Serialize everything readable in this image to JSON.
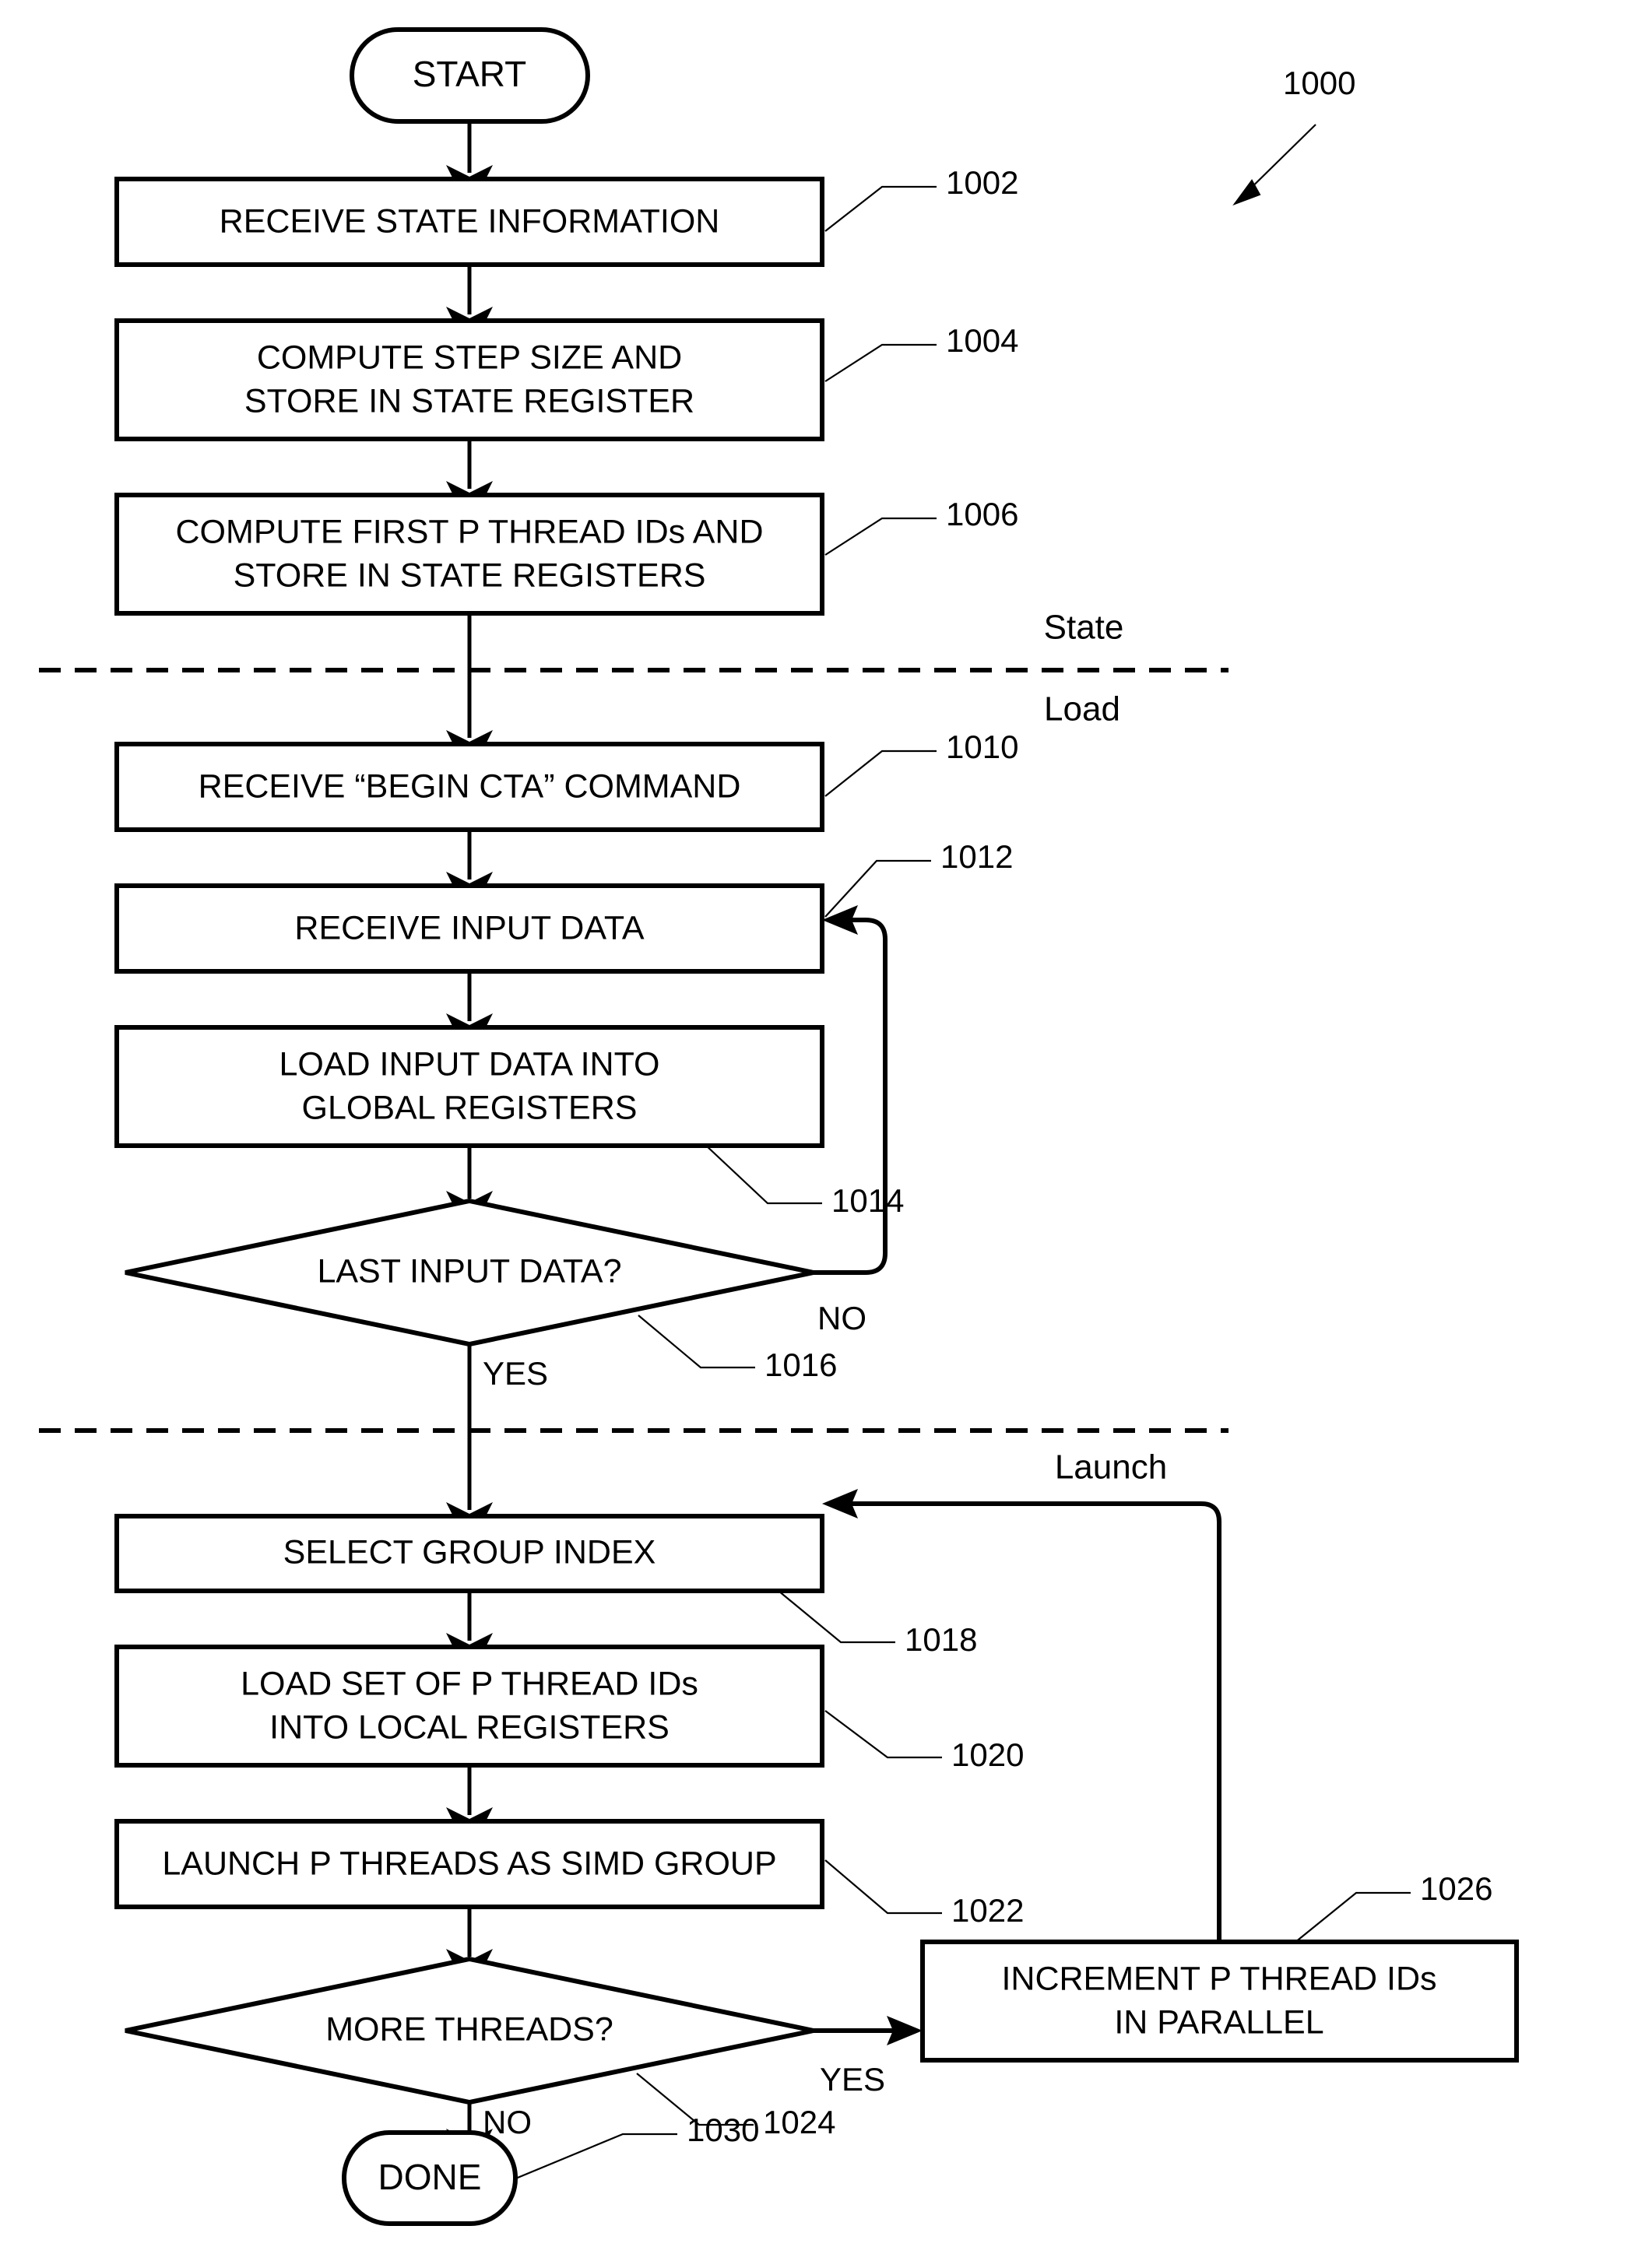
{
  "figure": {
    "number": "1000",
    "type": "flowchart"
  },
  "terminals": {
    "start": {
      "label": "START"
    },
    "done": {
      "label": "DONE",
      "ref": "1030"
    }
  },
  "steps": [
    {
      "id": "s1002",
      "ref": "1002",
      "lines": [
        "RECEIVE STATE INFORMATION"
      ]
    },
    {
      "id": "s1004",
      "ref": "1004",
      "lines": [
        "COMPUTE STEP SIZE AND",
        "STORE IN STATE REGISTER"
      ]
    },
    {
      "id": "s1006",
      "ref": "1006",
      "lines": [
        "COMPUTE FIRST P THREAD IDs AND",
        "STORE IN STATE REGISTERS"
      ]
    },
    {
      "id": "s1010",
      "ref": "1010",
      "lines": [
        "RECEIVE “BEGIN CTA” COMMAND"
      ]
    },
    {
      "id": "s1012",
      "ref": "1012",
      "lines": [
        "RECEIVE INPUT DATA"
      ]
    },
    {
      "id": "s1014",
      "ref": "1014",
      "lines": [
        "LOAD INPUT DATA INTO",
        "GLOBAL REGISTERS"
      ]
    },
    {
      "id": "s1018",
      "ref": "1018",
      "lines": [
        "SELECT GROUP INDEX"
      ]
    },
    {
      "id": "s1020",
      "ref": "1020",
      "lines": [
        "LOAD SET OF P THREAD IDs",
        "INTO LOCAL REGISTERS"
      ]
    },
    {
      "id": "s1022",
      "ref": "1022",
      "lines": [
        "LAUNCH P THREADS AS SIMD GROUP"
      ]
    },
    {
      "id": "s1026",
      "ref": "1026",
      "lines": [
        "INCREMENT P THREAD IDs",
        "IN PARALLEL"
      ]
    }
  ],
  "decisions": [
    {
      "id": "d1016",
      "ref": "1016",
      "label": "LAST INPUT DATA?",
      "yes_label": "YES",
      "no_label": "NO"
    },
    {
      "id": "d1024",
      "ref": "1024",
      "label": "MORE THREADS?",
      "yes_label": "YES",
      "no_label": "NO"
    }
  ],
  "phases": [
    {
      "id": "phase-state",
      "label": "State"
    },
    {
      "id": "phase-load",
      "label": "Load"
    },
    {
      "id": "phase-launch",
      "label": "Launch"
    }
  ],
  "colors": {
    "stroke": "#000000",
    "fill": "#ffffff",
    "background": "#ffffff"
  }
}
